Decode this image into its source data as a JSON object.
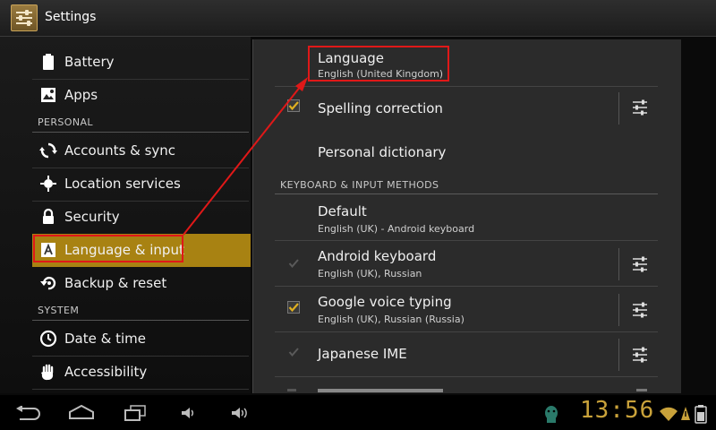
{
  "app": {
    "title": "Settings",
    "icon": "settings-sliders-icon"
  },
  "sidebar": {
    "items_top": [
      {
        "label": "Battery",
        "icon": "battery-icon"
      },
      {
        "label": "Apps",
        "icon": "apps-icon"
      }
    ],
    "personal_header": "PERSONAL",
    "personal_items": [
      {
        "label": "Accounts & sync",
        "icon": "sync-icon"
      },
      {
        "label": "Location services",
        "icon": "location-icon"
      },
      {
        "label": "Security",
        "icon": "lock-icon"
      },
      {
        "label": "Language & input",
        "icon": "language-icon",
        "selected": true
      },
      {
        "label": "Backup & reset",
        "icon": "backup-icon"
      }
    ],
    "system_header": "SYSTEM",
    "system_items": [
      {
        "label": "Date & time",
        "icon": "clock-icon"
      },
      {
        "label": "Accessibility",
        "icon": "hand-icon"
      }
    ]
  },
  "detail": {
    "language": {
      "title": "Language",
      "summary": "English (United Kingdom)"
    },
    "spelling": {
      "title": "Spelling correction",
      "checked": true
    },
    "dictionary": {
      "title": "Personal dictionary"
    },
    "keyboard_header": "KEYBOARD & INPUT METHODS",
    "default": {
      "title": "Default",
      "summary": "English (UK) - Android keyboard"
    },
    "android_keyboard": {
      "title": "Android keyboard",
      "summary": "English (UK), Russian",
      "checked": true,
      "enabled": false
    },
    "google_voice": {
      "title": "Google voice typing",
      "summary": "English (UK), Russian (Russia)",
      "checked": true,
      "enabled": true
    },
    "japanese_ime": {
      "title": "Japanese IME",
      "checked": true,
      "enabled": false
    }
  },
  "status_bar": {
    "time": "13:56"
  },
  "colors": {
    "accent": "#a88212",
    "highlight": "#e01818",
    "clock": "#c9a23a"
  }
}
